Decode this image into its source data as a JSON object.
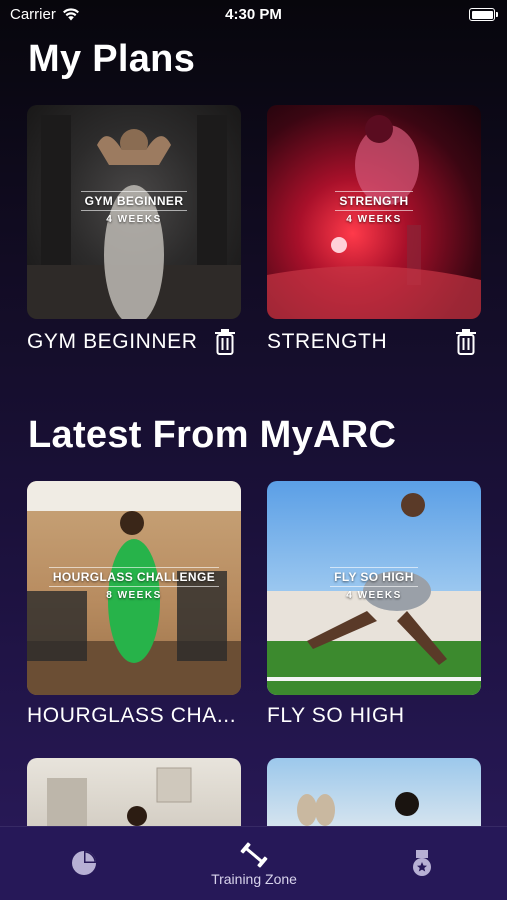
{
  "status_bar": {
    "carrier": "Carrier",
    "time": "4:30 PM"
  },
  "sections": {
    "my_plans": {
      "title": "My Plans"
    },
    "latest": {
      "title": "Latest From MyARC"
    }
  },
  "my_plans": [
    {
      "overlay_title": "GYM BEGINNER",
      "overlay_sub": "4 WEEKS",
      "caption": "GYM BEGINNER"
    },
    {
      "overlay_title": "STRENGTH",
      "overlay_sub": "4 WEEKS",
      "caption": "STRENGTH"
    }
  ],
  "latest": [
    {
      "overlay_title": "HOURGLASS CHALLENGE",
      "overlay_sub": "8 WEEKS",
      "caption": "HOURGLASS CHA..."
    },
    {
      "overlay_title": "FLY SO HIGH",
      "overlay_sub": "4 WEEKS",
      "caption": "FLY SO HIGH"
    }
  ],
  "tab_bar": {
    "tabs": [
      {
        "icon": "pie-chart-icon",
        "label": ""
      },
      {
        "icon": "dumbbell-icon",
        "label": "Training Zone"
      },
      {
        "icon": "medal-icon",
        "label": ""
      }
    ]
  },
  "colors": {
    "background_top": "#07060c",
    "background_bottom": "#2a1a5c",
    "tab_bar": "#261858"
  }
}
